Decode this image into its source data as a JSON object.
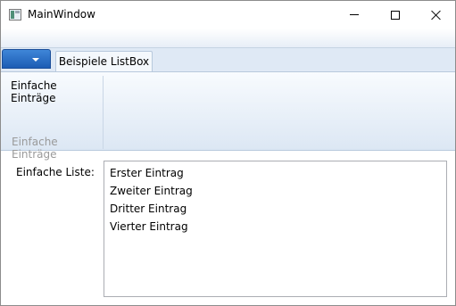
{
  "window": {
    "title": "MainWindow",
    "icon": "app-window-icon",
    "controls": [
      "minimize-icon",
      "maximize-icon",
      "close-icon"
    ]
  },
  "ribbon": {
    "app_menu_icon": "chevron-down-icon",
    "tabs": [
      {
        "label": "Beispiele ListBox",
        "selected": true
      }
    ],
    "groups": [
      {
        "button_label": "Einfache Einträge",
        "group_label": "Einfache Einträge"
      }
    ]
  },
  "content": {
    "list_label": "Einfache Liste:",
    "list_items": [
      "Erster Eintrag",
      "Zweiter Eintrag",
      "Dritter Eintrag",
      "Vierter Eintrag"
    ]
  }
}
